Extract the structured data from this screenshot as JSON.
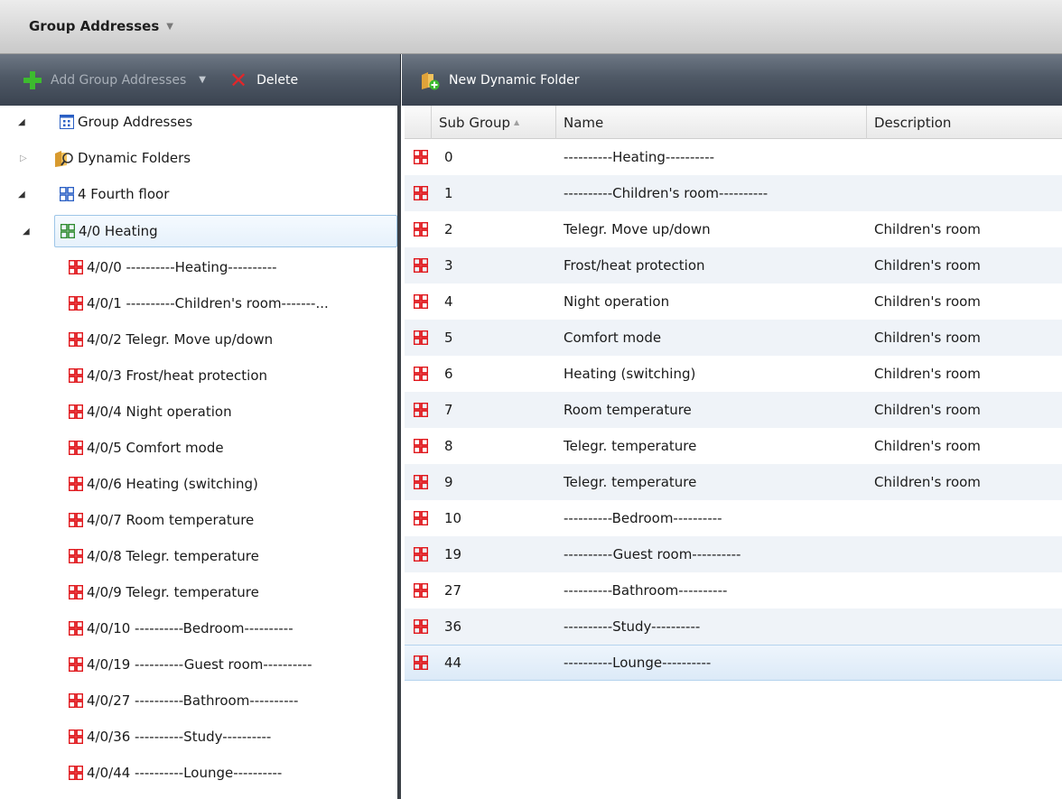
{
  "window": {
    "title": "Group Addresses"
  },
  "toolbar_left": {
    "add_label": "Add Group Addresses",
    "delete_label": "Delete"
  },
  "toolbar_right": {
    "new_dynamic_folder_label": "New Dynamic Folder"
  },
  "colors": {
    "address_icon_red": "#e0161b",
    "middle_group_green": "#2e8b2e",
    "main_group_blue": "#2a5fc4",
    "selection": "#dceaf8",
    "toolbar_dark": "#3a4350"
  },
  "tree": {
    "root": {
      "label": "Group Addresses",
      "icon": "group-addresses-icon"
    },
    "dynamic": {
      "label": "Dynamic Folders",
      "icon": "dynamic-folder-icon"
    },
    "main_group": {
      "label": "4 Fourth floor",
      "icon": "main-group-icon"
    },
    "middle_group": {
      "label": "4/0 Heating",
      "icon": "middle-group-icon"
    },
    "items": [
      "4/0/0 ----------Heating----------",
      "4/0/1 ----------Children's room-------...",
      "4/0/2 Telegr. Move up/down",
      "4/0/3 Frost/heat protection",
      "4/0/4 Night operation",
      "4/0/5 Comfort mode",
      "4/0/6 Heating (switching)",
      "4/0/7 Room temperature",
      "4/0/8 Telegr. temperature",
      "4/0/9 Telegr. temperature",
      "4/0/10 ----------Bedroom----------",
      "4/0/19 ----------Guest room----------",
      "4/0/27 ----------Bathroom----------",
      "4/0/36 ----------Study----------",
      "4/0/44 ----------Lounge----------"
    ]
  },
  "grid": {
    "columns": [
      "Sub Group",
      "Name",
      "Description"
    ],
    "sorted_column": "Sub Group",
    "rows": [
      {
        "sub": "0",
        "name": "----------Heating----------",
        "desc": ""
      },
      {
        "sub": "1",
        "name": "----------Children's room----------",
        "desc": ""
      },
      {
        "sub": "2",
        "name": "Telegr. Move up/down",
        "desc": "Children's room"
      },
      {
        "sub": "3",
        "name": "Frost/heat protection",
        "desc": "Children's room"
      },
      {
        "sub": "4",
        "name": "Night operation",
        "desc": "Children's room"
      },
      {
        "sub": "5",
        "name": "Comfort mode",
        "desc": "Children's room"
      },
      {
        "sub": "6",
        "name": "Heating (switching)",
        "desc": "Children's room"
      },
      {
        "sub": "7",
        "name": "Room temperature",
        "desc": "Children's room"
      },
      {
        "sub": "8",
        "name": "Telegr. temperature",
        "desc": "Children's room"
      },
      {
        "sub": "9",
        "name": "Telegr. temperature",
        "desc": "Children's room"
      },
      {
        "sub": "10",
        "name": "----------Bedroom----------",
        "desc": ""
      },
      {
        "sub": "19",
        "name": "----------Guest room----------",
        "desc": ""
      },
      {
        "sub": "27",
        "name": "----------Bathroom----------",
        "desc": ""
      },
      {
        "sub": "36",
        "name": "----------Study----------",
        "desc": ""
      },
      {
        "sub": "44",
        "name": "----------Lounge----------",
        "desc": ""
      }
    ],
    "selected_row": "44"
  }
}
